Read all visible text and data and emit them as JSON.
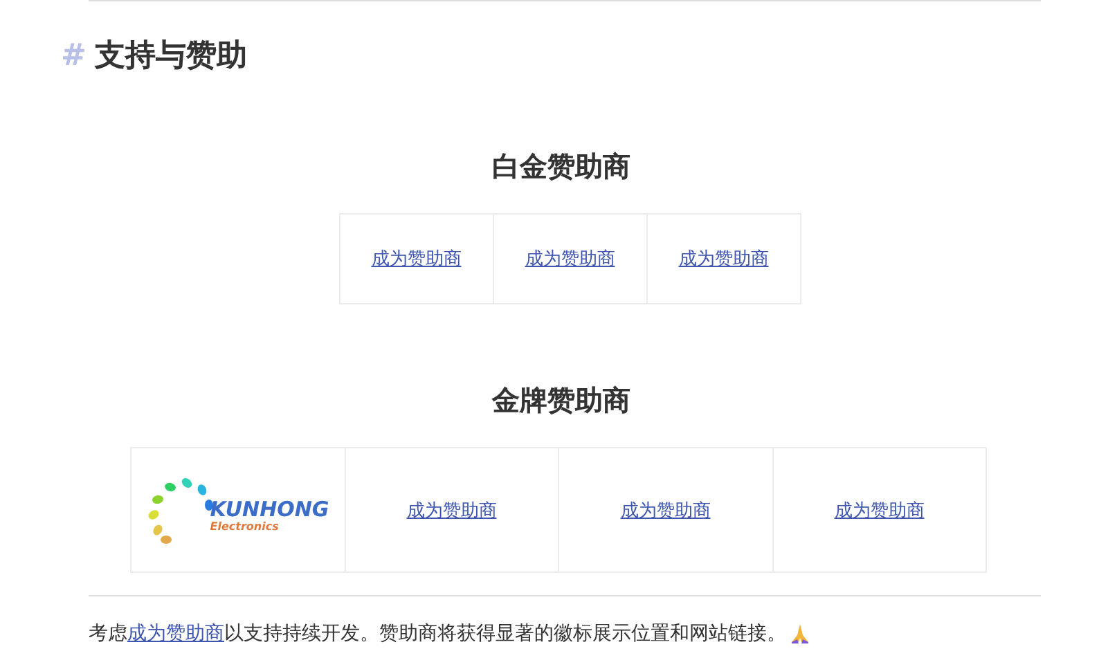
{
  "heading": {
    "mark": "#",
    "title": "支持与赞助"
  },
  "tiers": [
    {
      "title": "白金赞助商",
      "sponsors": [
        {
          "kind": "link",
          "text": "成为赞助商"
        },
        {
          "kind": "link",
          "text": "成为赞助商"
        },
        {
          "kind": "link",
          "text": "成为赞助商"
        }
      ]
    },
    {
      "title": "金牌赞助商",
      "sponsors": [
        {
          "kind": "logo",
          "name": "KUNHONG",
          "subtitle": "Electronics"
        },
        {
          "kind": "link",
          "text": "成为赞助商"
        },
        {
          "kind": "link",
          "text": "成为赞助商"
        },
        {
          "kind": "link",
          "text": "成为赞助商"
        }
      ]
    }
  ],
  "note": {
    "before": "考虑",
    "link": "成为赞助商",
    "after": "以支持持续开发。赞助商将获得显著的徽标展示位置和网站链接。"
  }
}
